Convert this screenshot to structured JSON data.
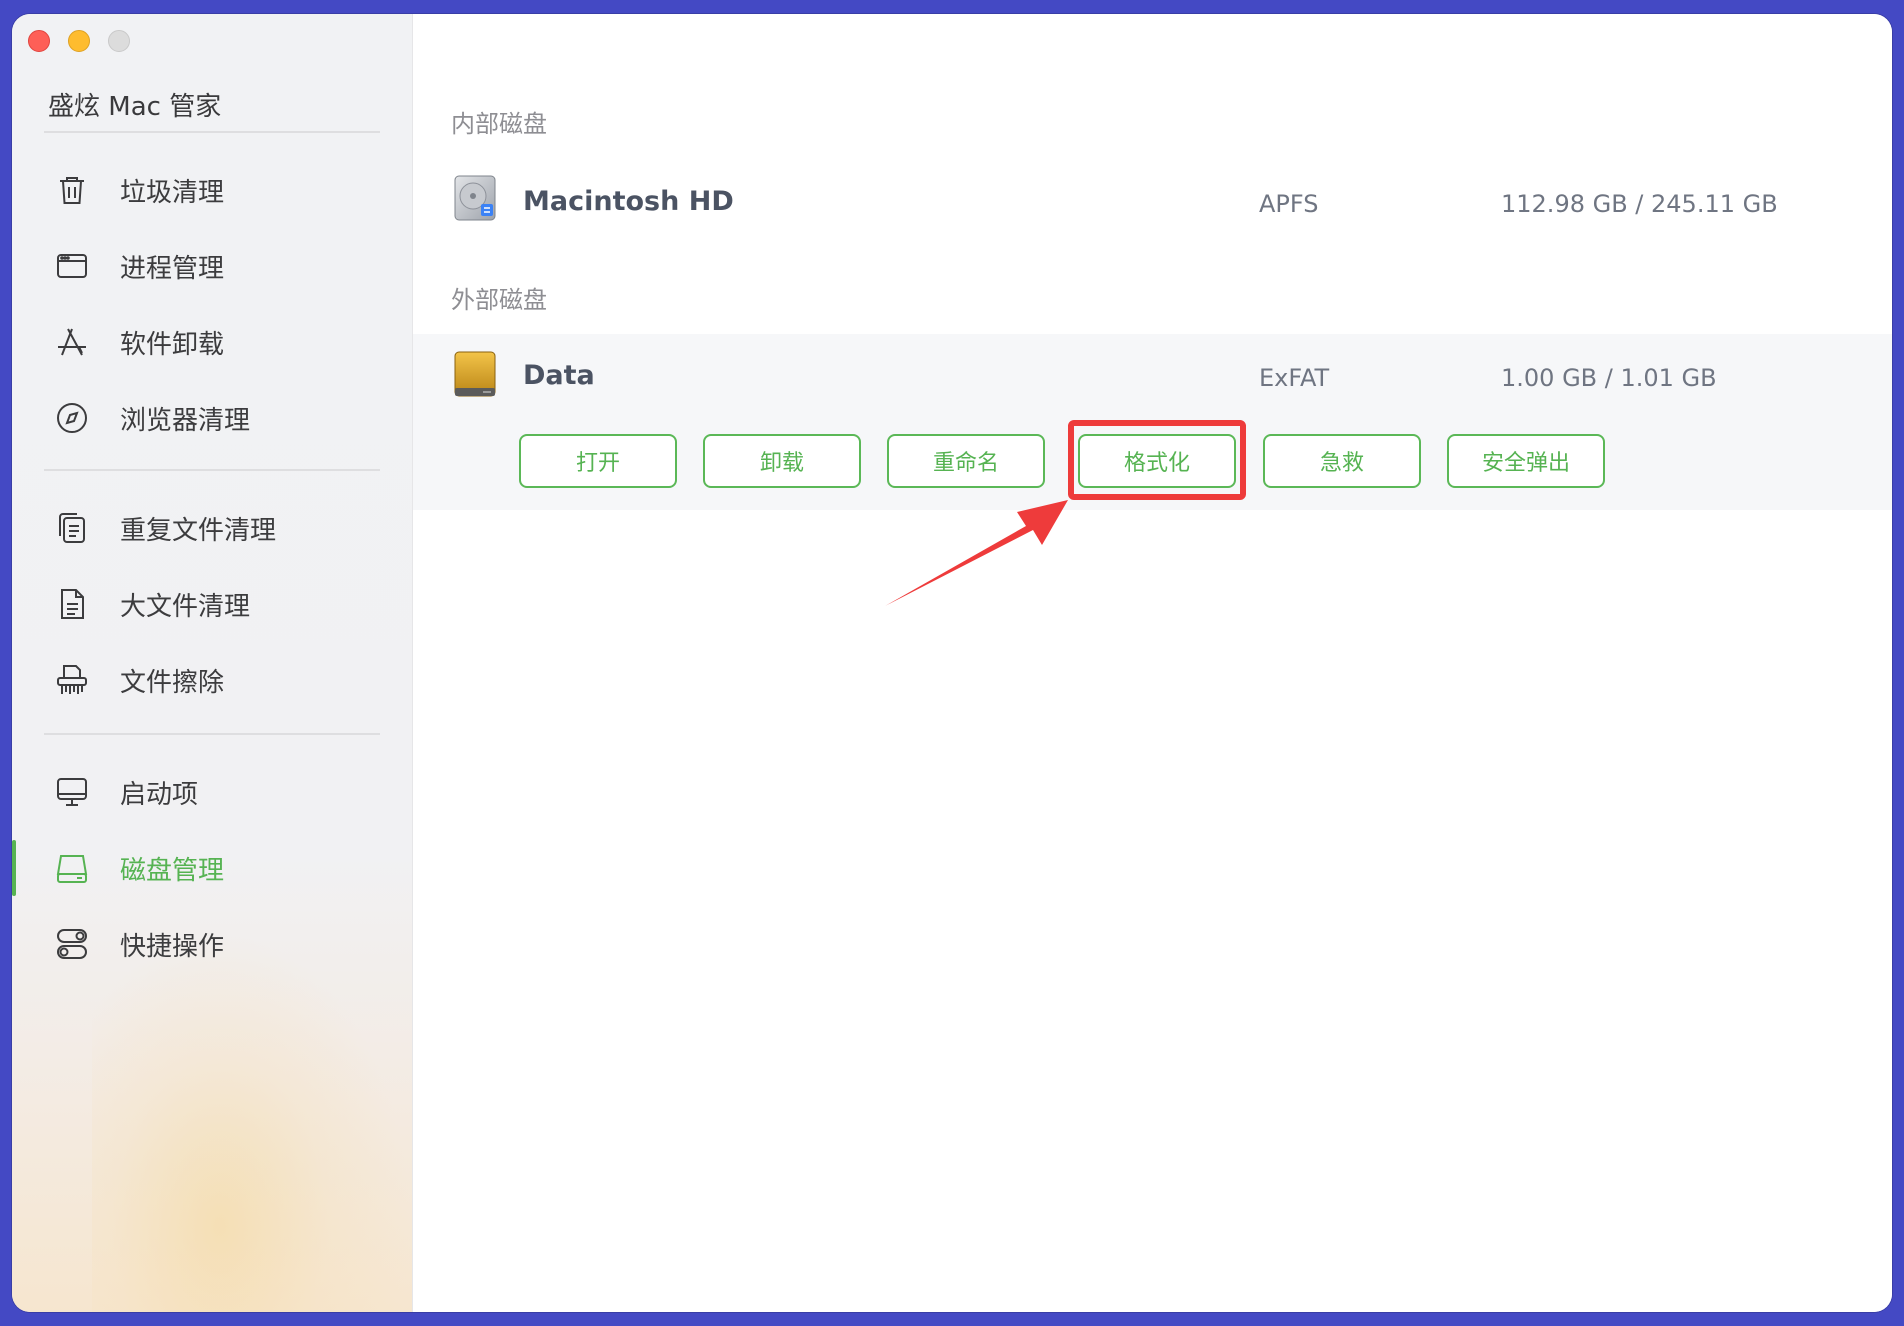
{
  "app": {
    "title": "盛炫 Mac 管家"
  },
  "sidebar": {
    "groups": [
      [
        {
          "label": "垃圾清理",
          "icon": "trash-icon"
        },
        {
          "label": "进程管理",
          "icon": "window-icon"
        },
        {
          "label": "软件卸载",
          "icon": "app-store-icon"
        },
        {
          "label": "浏览器清理",
          "icon": "compass-icon"
        }
      ],
      [
        {
          "label": "重复文件清理",
          "icon": "duplicate-files-icon"
        },
        {
          "label": "大文件清理",
          "icon": "document-icon"
        },
        {
          "label": "文件擦除",
          "icon": "shredder-icon"
        }
      ],
      [
        {
          "label": "启动项",
          "icon": "monitor-icon"
        },
        {
          "label": "磁盘管理",
          "icon": "disk-icon",
          "active": true
        },
        {
          "label": "快捷操作",
          "icon": "toggles-icon"
        }
      ]
    ]
  },
  "main": {
    "internal_label": "内部磁盘",
    "external_label": "外部磁盘",
    "internal_disk": {
      "name": "Macintosh HD",
      "fs": "APFS",
      "size": "112.98 GB / 245.11 GB",
      "icon": "hard-drive-icon"
    },
    "external_disk": {
      "name": "Data",
      "fs": "ExFAT",
      "size": "1.00 GB / 1.01 GB",
      "icon": "external-drive-icon"
    },
    "actions": [
      "打开",
      "卸载",
      "重命名",
      "格式化",
      "急救",
      "安全弹出"
    ],
    "highlighted_action": "格式化"
  },
  "colors": {
    "accent": "#56b352",
    "highlight": "#ee3b3b",
    "background": "#4449c4"
  }
}
